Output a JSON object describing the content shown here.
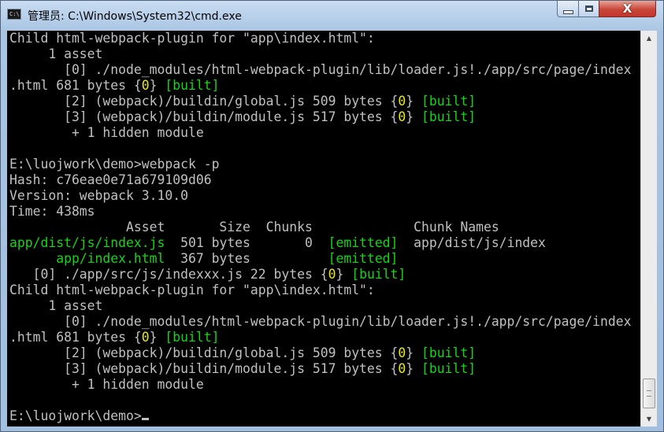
{
  "window": {
    "title": "管理员: C:\\Windows\\System32\\cmd.exe",
    "app_icon_text": "C:\\",
    "close_glyph": "X"
  },
  "scrollbar": {
    "up_arrow": "▲",
    "down_arrow": "▼"
  },
  "console": {
    "lines": [
      [
        {
          "t": "Child html-webpack-plugin for \"app\\index.html\":"
        }
      ],
      [
        {
          "t": "     1 asset"
        }
      ],
      [
        {
          "t": "       [0] ./node_modules/html-webpack-plugin/lib/loader.js!./app/src/page/index"
        }
      ],
      [
        {
          "t": ".html 681 bytes {"
        },
        {
          "t": "0",
          "c": "y"
        },
        {
          "t": "} "
        },
        {
          "t": "[built]",
          "c": "g"
        }
      ],
      [
        {
          "t": "       [2] (webpack)/buildin/global.js 509 bytes {"
        },
        {
          "t": "0",
          "c": "y"
        },
        {
          "t": "} "
        },
        {
          "t": "[built]",
          "c": "g"
        }
      ],
      [
        {
          "t": "       [3] (webpack)/buildin/module.js 517 bytes {"
        },
        {
          "t": "0",
          "c": "y"
        },
        {
          "t": "} "
        },
        {
          "t": "[built]",
          "c": "g"
        }
      ],
      [
        {
          "t": "        + 1 hidden module"
        }
      ],
      [
        {
          "t": ""
        }
      ],
      [
        {
          "t": "E:\\luojwork\\demo>webpack -p"
        }
      ],
      [
        {
          "t": "Hash: c76eae0e71a679109d06"
        }
      ],
      [
        {
          "t": "Version: webpack 3.10.0"
        }
      ],
      [
        {
          "t": "Time: 438ms"
        }
      ],
      [
        {
          "t": "               Asset       Size  Chunks             Chunk Names"
        }
      ],
      [
        {
          "t": "app/dist/js/index.js",
          "c": "g"
        },
        {
          "t": "  501 bytes       0  "
        },
        {
          "t": "[emitted]",
          "c": "g"
        },
        {
          "t": "  app/dist/js/index"
        }
      ],
      [
        {
          "t": "      "
        },
        {
          "t": "app/index.html",
          "c": "g"
        },
        {
          "t": "  367 bytes          "
        },
        {
          "t": "[emitted]",
          "c": "g"
        }
      ],
      [
        {
          "t": "   [0] ./app/src/js/indexxx.js 22 bytes {"
        },
        {
          "t": "0",
          "c": "y"
        },
        {
          "t": "} "
        },
        {
          "t": "[built]",
          "c": "g"
        }
      ],
      [
        {
          "t": "Child html-webpack-plugin for \"app\\index.html\":"
        }
      ],
      [
        {
          "t": "     1 asset"
        }
      ],
      [
        {
          "t": "       [0] ./node_modules/html-webpack-plugin/lib/loader.js!./app/src/page/index"
        }
      ],
      [
        {
          "t": ".html 681 bytes {"
        },
        {
          "t": "0",
          "c": "y"
        },
        {
          "t": "} "
        },
        {
          "t": "[built]",
          "c": "g"
        }
      ],
      [
        {
          "t": "       [2] (webpack)/buildin/global.js 509 bytes {"
        },
        {
          "t": "0",
          "c": "y"
        },
        {
          "t": "} "
        },
        {
          "t": "[built]",
          "c": "g"
        }
      ],
      [
        {
          "t": "       [3] (webpack)/buildin/module.js 517 bytes {"
        },
        {
          "t": "0",
          "c": "y"
        },
        {
          "t": "} "
        },
        {
          "t": "[built]",
          "c": "g"
        }
      ],
      [
        {
          "t": "        + 1 hidden module"
        }
      ],
      [
        {
          "t": ""
        }
      ],
      [
        {
          "t": "E:\\luojwork\\demo>"
        }
      ]
    ],
    "colors": {
      "default": "#c0c0c0",
      "green": "#13d613",
      "yellow": "#e6e61c"
    }
  }
}
